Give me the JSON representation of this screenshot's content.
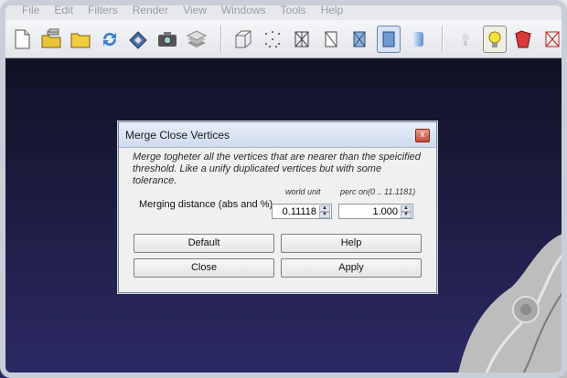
{
  "menu": [
    "File",
    "Edit",
    "Filters",
    "Render",
    "View",
    "Windows",
    "Tools",
    "Help"
  ],
  "toolbar": {
    "icons": [
      "new-document-icon",
      "open-project-icon",
      "open-folder-icon",
      "reload-icon",
      "save-icon",
      "snapshot-camera-icon",
      "layers-icon",
      "bbox-icon",
      "points-icon",
      "wireframe-icon",
      "hidden-lines-icon",
      "flat-lines-icon",
      "flat-icon",
      "smooth-icon",
      "texture-icon",
      "light-icon",
      "color-icon",
      "extra-icon"
    ]
  },
  "dialog": {
    "title": "Merge Close Vertices",
    "close_label": "x",
    "description": "Merge togheter all the vertices that are nearer than the speicified threshold. Like a unify duplicated vertices but with some tolerance.",
    "unit_label_world": "world unit",
    "unit_label_perc": "perc on(0 .. 11.1181)",
    "row_label": "Merging distance (abs and %)",
    "abs_value": "0.11118",
    "perc_value": "1.000",
    "buttons": {
      "default": "Default",
      "help": "Help",
      "close": "Close",
      "apply": "Apply"
    }
  }
}
